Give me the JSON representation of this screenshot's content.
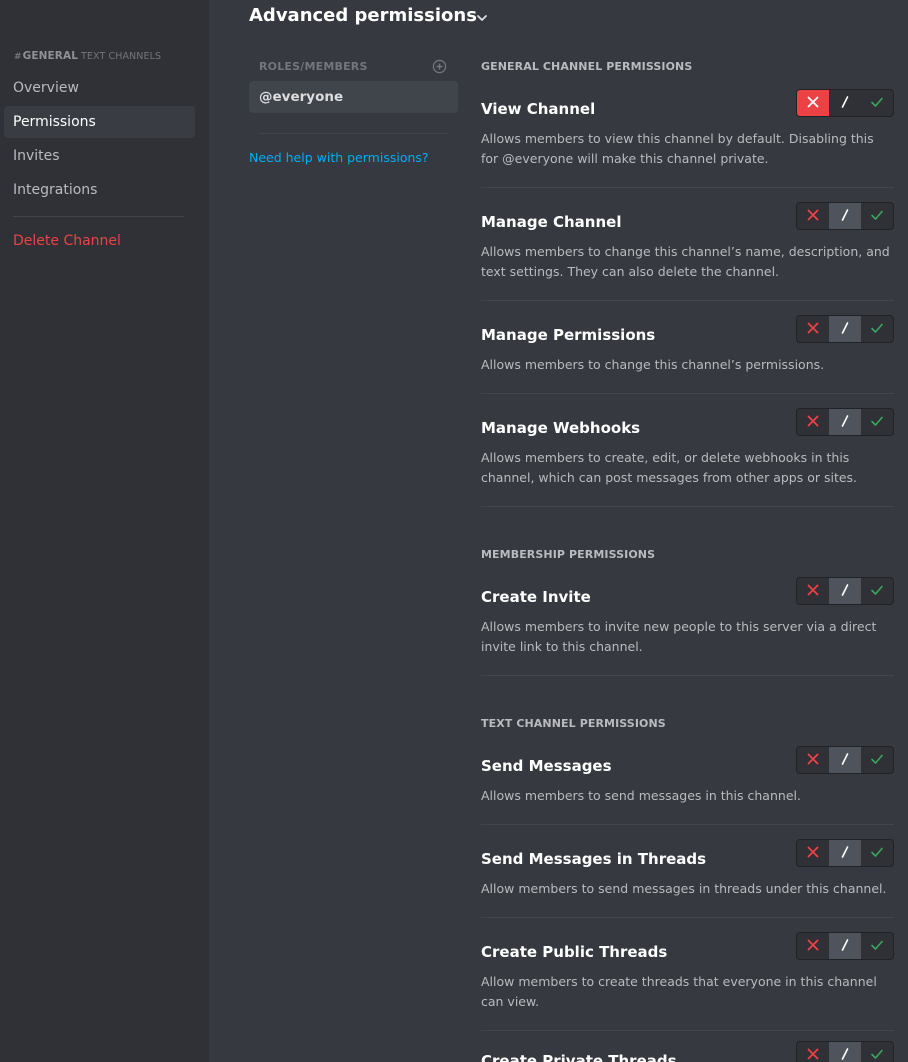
{
  "sidebar": {
    "header_name": "GENERAL",
    "header_sub": "TEXT CHANNELS",
    "items": [
      {
        "label": "Overview",
        "active": false
      },
      {
        "label": "Permissions",
        "active": true
      },
      {
        "label": "Invites",
        "active": false
      },
      {
        "label": "Integrations",
        "active": false
      }
    ],
    "delete_label": "Delete Channel"
  },
  "main": {
    "title": "Advanced permissions",
    "roles_header": "ROLES/MEMBERS",
    "roles": [
      {
        "label": "@everyone",
        "selected": true
      }
    ],
    "help_link": "Need help with permissions?"
  },
  "colors": {
    "deny": "#ed4245",
    "allow": "#3ba55d",
    "link": "#00aff4"
  },
  "sections": [
    {
      "title": "GENERAL CHANNEL PERMISSIONS",
      "permissions": [
        {
          "name": "View Channel",
          "desc": "Allows members to view this channel by default. Disabling this for @everyone will make this channel private.",
          "state": "deny"
        },
        {
          "name": "Manage Channel",
          "desc": "Allows members to change this channel’s name, description, and text settings. They can also delete the channel.",
          "state": "neutral"
        },
        {
          "name": "Manage Permissions",
          "desc": "Allows members to change this channel’s permissions.",
          "state": "neutral"
        },
        {
          "name": "Manage Webhooks",
          "desc": "Allows members to create, edit, or delete webhooks in this channel, which can post messages from other apps or sites.",
          "state": "neutral"
        }
      ]
    },
    {
      "title": "MEMBERSHIP PERMISSIONS",
      "permissions": [
        {
          "name": "Create Invite",
          "desc": "Allows members to invite new people to this server via a direct invite link to this channel.",
          "state": "neutral"
        }
      ]
    },
    {
      "title": "TEXT CHANNEL PERMISSIONS",
      "permissions": [
        {
          "name": "Send Messages",
          "desc": "Allows members to send messages in this channel.",
          "state": "neutral"
        },
        {
          "name": "Send Messages in Threads",
          "desc": "Allow members to send messages in threads under this channel.",
          "state": "neutral"
        },
        {
          "name": "Create Public Threads",
          "desc": "Allow members to create threads that everyone in this channel can view.",
          "state": "neutral"
        },
        {
          "name": "Create Private Threads",
          "desc": "",
          "state": "neutral"
        }
      ]
    }
  ]
}
